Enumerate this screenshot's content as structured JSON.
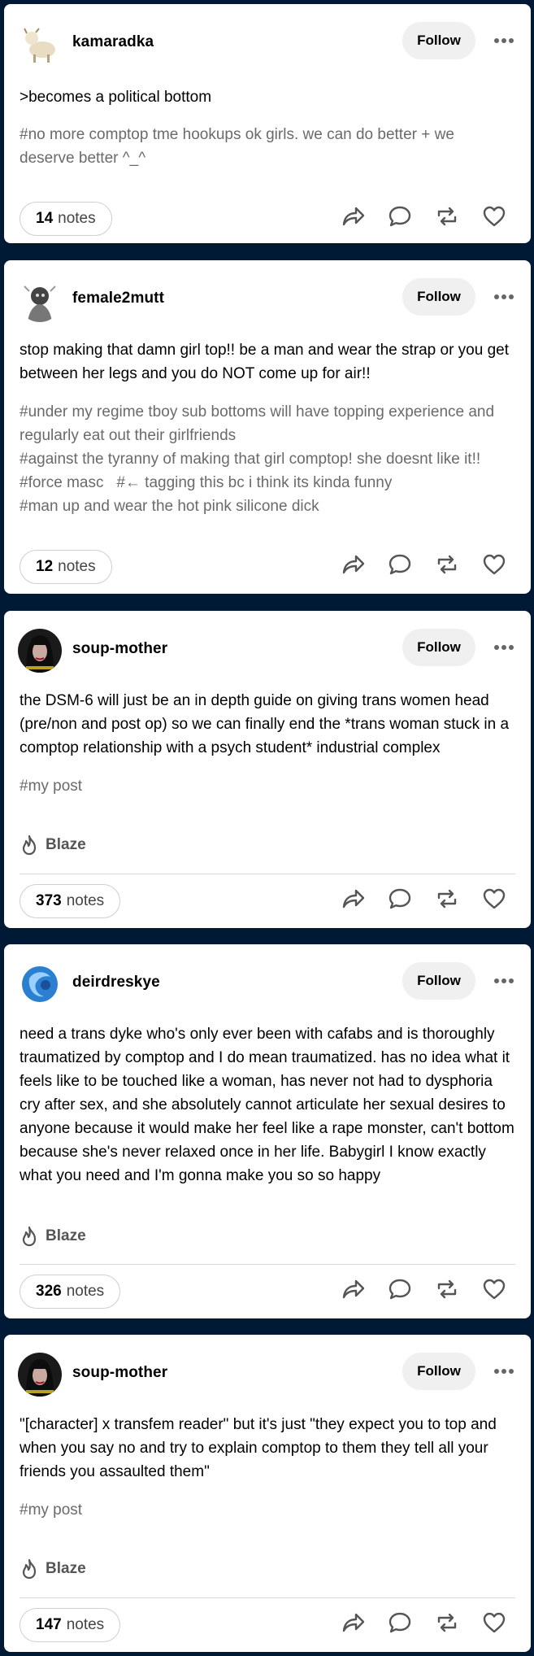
{
  "posts": [
    {
      "username": "kamaradka",
      "follow_label": "Follow",
      "body": ">becomes a political bottom",
      "tags": [
        "#no more comptop tme hookups ok girls. we can do better + we",
        "deserve better ^_^"
      ],
      "blaze_label": null,
      "notes_count": "14",
      "notes_word": "notes"
    },
    {
      "username": "female2mutt",
      "follow_label": "Follow",
      "body": "stop making that damn girl top!! be a man and wear the strap or you get between her legs and you do NOT come up for air!!",
      "tags": [
        "#under my regime tboy sub bottoms will have topping experience and",
        "regularly eat out their girlfriends",
        "#against the tyranny of making that girl comptop! she doesnt like it!!",
        "#force masc   #← tagging this bc i think its kinda funny",
        "#man up and wear the hot pink silicone dick"
      ],
      "blaze_label": null,
      "notes_count": "12",
      "notes_word": "notes"
    },
    {
      "username": "soup-mother",
      "follow_label": "Follow",
      "body": "the DSM-6 will just be an in depth guide on giving trans women head (pre/non and post op) so we can finally end the *trans woman stuck in a comptop relationship with a psych student* industrial complex",
      "tags": [
        "#my post"
      ],
      "blaze_label": "Blaze",
      "notes_count": "373",
      "notes_word": "notes"
    },
    {
      "username": "deirdreskye",
      "follow_label": "Follow",
      "body": "need a trans dyke who's only ever been with cafabs and is thoroughly traumatized by comptop and I do mean traumatized. has no idea what it feels like to be touched like a woman, has never not had to dysphoria cry after sex, and she absolutely cannot articulate her sexual desires to anyone because it would make her feel like a rape monster, can't bottom because she's never relaxed once in her life. Babygirl I know exactly what you need and I'm gonna make you so so happy",
      "tags": [],
      "blaze_label": "Blaze",
      "notes_count": "326",
      "notes_word": "notes"
    },
    {
      "username": "soup-mother",
      "follow_label": "Follow",
      "body": "\"[character] x transfem reader\" but it's just \"they expect you to top and when you say no and try to explain comptop to them they tell all your friends you assaulted them\"",
      "tags": [
        "#my post"
      ],
      "blaze_label": "Blaze",
      "notes_count": "147",
      "notes_word": "notes"
    }
  ],
  "icons": {
    "more": "more-horizontal-icon",
    "share": "share-arrow-icon",
    "reply": "comment-bubble-icon",
    "reblog": "reblog-icon",
    "like": "heart-icon",
    "blaze": "flame-icon"
  },
  "colors": {
    "background": "#001935",
    "card": "#ffffff",
    "tag_text": "#6a6a6a",
    "follow_bg": "#f0f0f0"
  }
}
